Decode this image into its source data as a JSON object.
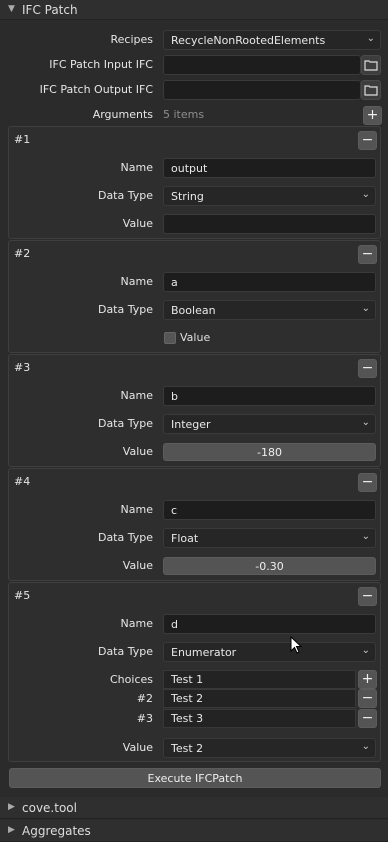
{
  "panel": {
    "title": "IFC Patch"
  },
  "recipes": {
    "label": "Recipes",
    "value": "RecycleNonRootedElements"
  },
  "input_ifc": {
    "label": "IFC Patch Input IFC",
    "value": ""
  },
  "output_ifc": {
    "label": "IFC Patch Output IFC",
    "value": ""
  },
  "arguments": {
    "label": "Arguments",
    "count": "5 items"
  },
  "labels": {
    "name": "Name",
    "data_type": "Data Type",
    "value": "Value",
    "choices": "Choices"
  },
  "args": [
    {
      "title": "#1",
      "name": "output",
      "data_type": "String",
      "value": ""
    },
    {
      "title": "#2",
      "name": "a",
      "data_type": "Boolean",
      "value_label": "Value"
    },
    {
      "title": "#3",
      "name": "b",
      "data_type": "Integer",
      "value": "-180"
    },
    {
      "title": "#4",
      "name": "c",
      "data_type": "Float",
      "value": "-0.30"
    },
    {
      "title": "#5",
      "name": "d",
      "data_type": "Enumerator",
      "value": "Test 2",
      "choices": [
        {
          "index": "",
          "text": "Test 1"
        },
        {
          "index": "#2",
          "text": "Test 2"
        },
        {
          "index": "#3",
          "text": "Test 3"
        }
      ]
    }
  ],
  "execute": {
    "label": "Execute IFCPatch"
  },
  "next_panels": [
    {
      "title": "cove.tool"
    },
    {
      "title": "Aggregates"
    }
  ],
  "icons": {
    "remove": "minus-icon",
    "add": "plus-icon",
    "folder": "folder-icon",
    "expand": "triangle-right-icon",
    "collapse": "triangle-down-icon"
  }
}
